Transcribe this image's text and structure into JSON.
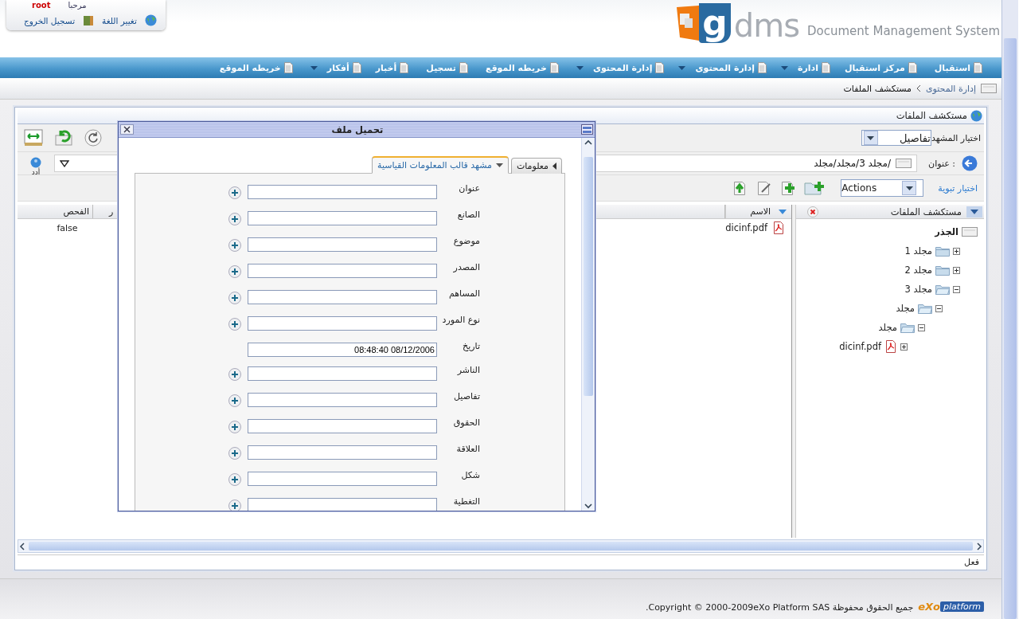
{
  "user_bar": {
    "greeting": "مرحبا",
    "username": "root",
    "links": [
      {
        "label": "تغيير اللغة",
        "kind": "language"
      },
      {
        "label": "تسجيل الخروج",
        "kind": "logout"
      }
    ]
  },
  "logo": {
    "mark": "g",
    "wordmark": "dms",
    "tagline": "Document Management System"
  },
  "nav": [
    {
      "label": "استقبال",
      "has_menu": false
    },
    {
      "label": "مركز استقبال",
      "has_menu": false
    },
    {
      "label": "ادارة",
      "has_menu": true
    },
    {
      "label": "إدارة المحتوى",
      "has_menu": true
    },
    {
      "label": "إدارة المحتوى",
      "has_menu": true
    },
    {
      "label": "خريطه الموقع",
      "has_menu": false
    },
    {
      "label": "تسجيل",
      "has_menu": false
    },
    {
      "label": "أخبار",
      "has_menu": false
    },
    {
      "label": "أفكار",
      "has_menu": true
    },
    {
      "label": "خريطه الموقع",
      "has_menu": false
    }
  ],
  "breadcrumb": [
    "إدارة المحتوى",
    "مستكشف الملفات"
  ],
  "explorer": {
    "title": "مستكشف الملفات",
    "view_label": "اختيار المشهد",
    "view_value": "تفاصيل",
    "side_label": "أدد",
    "address_label": "عنوان :",
    "path": "/مجلد 3/مجلد/مجلد",
    "tab_link": "اختيار تبوية",
    "actions": "Actions",
    "columns": [
      {
        "label": "ر"
      },
      {
        "label": "الفحص"
      }
    ],
    "name_column": "الاسم",
    "rows": [
      {
        "check": "false",
        "name": "dicinf.pdf"
      }
    ],
    "tree_title": "مستكشف الملفات",
    "tree": [
      {
        "label": "الجذر",
        "kind": "root",
        "children": [
          {
            "label": "مجلد 1",
            "kind": "folder",
            "expanded": false
          },
          {
            "label": "مجلد 2",
            "kind": "folder",
            "expanded": false
          },
          {
            "label": "مجلد 3",
            "kind": "folder",
            "expanded": true,
            "children": [
              {
                "label": "مجلد",
                "kind": "folder",
                "expanded": true,
                "children": [
                  {
                    "label": "مجلد",
                    "kind": "folder",
                    "expanded": true,
                    "children": [
                      {
                        "label": "dicinf.pdf",
                        "kind": "file",
                        "expanded": false
                      }
                    ]
                  }
                ]
              }
            ]
          }
        ]
      }
    ],
    "status": "فعل"
  },
  "dialog": {
    "title": "تحميل ملف",
    "tabs": [
      {
        "label": "معلومات",
        "selected": false
      },
      {
        "label": "مشهد قالب المعلومات القياسية",
        "selected": true
      }
    ],
    "fields": [
      {
        "label": "عنوان",
        "addable": true
      },
      {
        "label": "الصانع",
        "addable": true
      },
      {
        "label": "موضوع",
        "addable": true
      },
      {
        "label": "المصدر",
        "addable": true
      },
      {
        "label": "المساهم",
        "addable": true
      },
      {
        "label": "نوع المورد",
        "addable": true
      },
      {
        "label": "تاريخ",
        "value": "08:48:40 08/12/2006",
        "addable": false
      },
      {
        "label": "الناشر",
        "addable": true
      },
      {
        "label": "تفاصيل",
        "addable": true
      },
      {
        "label": "الحقوق",
        "addable": true
      },
      {
        "label": "العلاقة",
        "addable": true
      },
      {
        "label": "شكل",
        "addable": true
      },
      {
        "label": "التغطية",
        "addable": true
      }
    ]
  },
  "footer": {
    "text": "جميع الحقوق محفوظة Copyright © 2000-2009eXo Platform SAS.",
    "logo_mark": "eXo",
    "logo_word": "platform"
  }
}
